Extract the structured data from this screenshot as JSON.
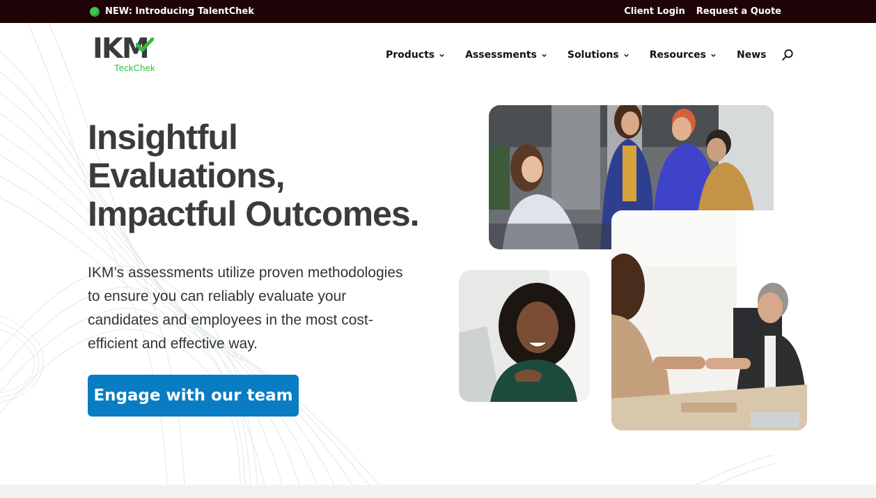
{
  "topbar": {
    "announcement": "NEW: Introducing TalentChek",
    "links": [
      "Client Login",
      "Request a Quote"
    ],
    "background": "#1e0307",
    "dot_color": "#3ecb4d"
  },
  "logo": {
    "mark": "IKM",
    "sub": "TeckChek",
    "accent": "#2fbf3f"
  },
  "nav": {
    "items": [
      {
        "label": "Products",
        "icon": "chevron-down-icon"
      },
      {
        "label": "Assessments",
        "icon": "chevron-down-icon"
      },
      {
        "label": "Solutions",
        "icon": "chevron-down-icon"
      },
      {
        "label": "Resources",
        "icon": "chevron-down-icon"
      },
      {
        "label": "News"
      }
    ],
    "search_icon": "search-icon"
  },
  "hero": {
    "title_lines": [
      "Insightful",
      "Evaluations,",
      "Impactful Outcomes."
    ],
    "body": "IKM’s assessments utilize proven methodologies to ensure you can reliably evaluate your candidates and employees in the most cost-efficient and effective way.",
    "cta_label": "Engage with our team",
    "cta_color": "#0a7cc4"
  },
  "images": [
    "team-meeting-photo",
    "smiling-woman-photo",
    "handshake-photo"
  ]
}
